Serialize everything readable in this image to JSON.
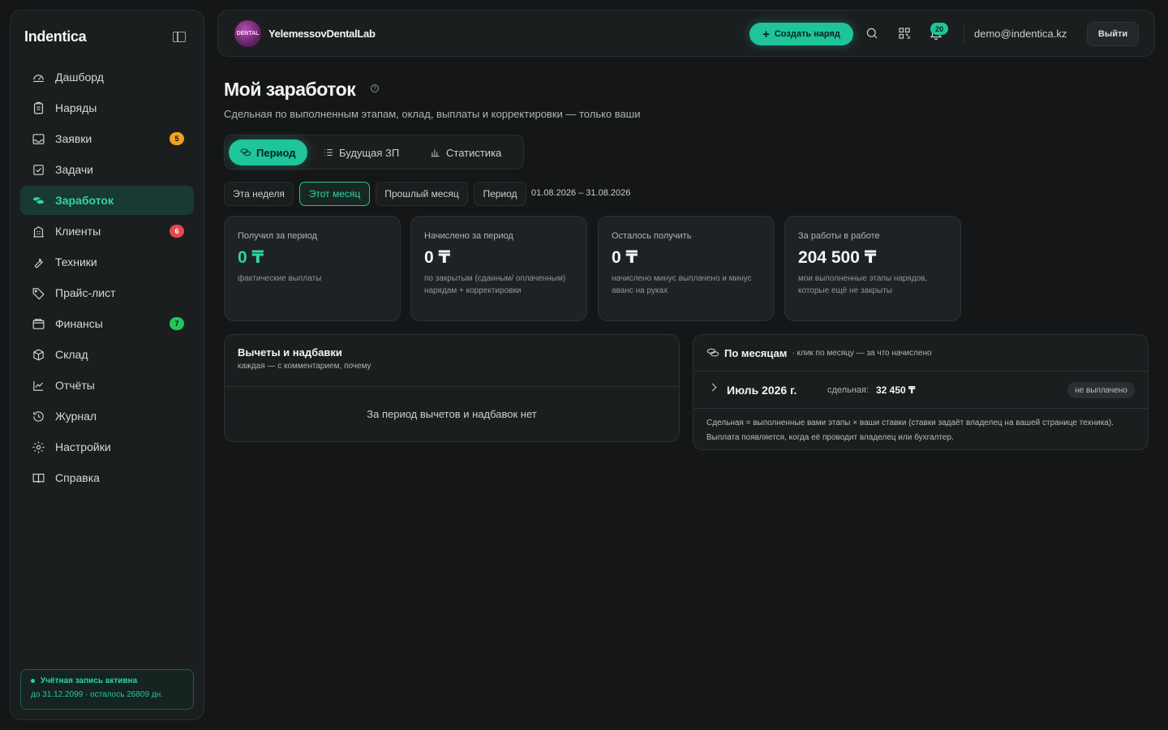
{
  "sidebar": {
    "brand": "Indentica",
    "items": [
      {
        "label": "Дашборд",
        "icon": "dashboard-icon"
      },
      {
        "label": "Наряды",
        "icon": "clipboard-icon"
      },
      {
        "label": "Заявки",
        "icon": "inbox-icon",
        "badge": "5",
        "badge_color": "#f0a020"
      },
      {
        "label": "Задачи",
        "icon": "checkbox-icon"
      },
      {
        "label": "Заработок",
        "icon": "coins-icon",
        "active": true
      },
      {
        "label": "Клиенты",
        "icon": "building-icon",
        "badge": "6",
        "badge_color": "#e5484d"
      },
      {
        "label": "Техники",
        "icon": "wrench-icon"
      },
      {
        "label": "Прайс-лист",
        "icon": "tag-icon"
      },
      {
        "label": "Финансы",
        "icon": "wallet-icon",
        "badge": "7",
        "badge_color": "#22c55e"
      },
      {
        "label": "Склад",
        "icon": "box-icon"
      },
      {
        "label": "Отчёты",
        "icon": "chart-line-icon"
      },
      {
        "label": "Журнал",
        "icon": "history-icon"
      },
      {
        "label": "Настройки",
        "icon": "gear-icon"
      },
      {
        "label": "Справка",
        "icon": "book-icon"
      }
    ],
    "account": {
      "status": "Учётная запись активна",
      "expires": "до 31.12.2099 · осталось 26809 дн."
    }
  },
  "header": {
    "lab_name": "YelemessovDentalLab",
    "avatar_text": "DENTAL",
    "create_label": "Создать наряд",
    "notifications_count": "20",
    "user_email": "demo@indentica.kz",
    "logout_label": "Выйти"
  },
  "page": {
    "title": "Мой заработок",
    "subtitle": "Сдельная по выполненным этапам, оклад, выплаты и корректировки — только ваши"
  },
  "tabs": [
    {
      "label": "Период",
      "active": true
    },
    {
      "label": "Будущая ЗП"
    },
    {
      "label": "Статистика"
    }
  ],
  "filters": {
    "this_week": "Эта неделя",
    "this_month": "Этот месяц",
    "last_month": "Прошлый месяц",
    "period": "Период",
    "range": "01.08.2026 – 31.08.2026"
  },
  "cards": [
    {
      "label": "Получил за период",
      "value": "0 ₸",
      "note": "фактические выплаты"
    },
    {
      "label": "Начислено за период",
      "value": "0 ₸",
      "note": "по закрытым (сданным/ оплаченным) нарядам + корректировки"
    },
    {
      "label": "Осталось получить",
      "value": "0 ₸",
      "note": "начислено минус выплачено и минус аванс на руках"
    },
    {
      "label": "За работы в работе",
      "value": "204 500 ₸",
      "note": "мои выполненные этапы нарядов, которые ещё не закрыты"
    }
  ],
  "deductions": {
    "title": "Вычеты и надбавки",
    "subtitle": "каждая — с комментарием, почему",
    "empty": "За период вычетов и надбавок нет"
  },
  "months": {
    "title": "По месяцам",
    "hint": "· клик по месяцу — за что начислено",
    "rows": [
      {
        "month": "Июль 2026 г.",
        "piece_label": "сдельная:",
        "piece_value": "32 450 ₸",
        "status": "не выплачено"
      }
    ],
    "explain": "Сдельная = выполненные вами этапы × ваши ставки (ставки задаёт владелец на вашей странице техника). Выплата появляется, когда её проводит владелец или бухгалтер."
  },
  "colors": {
    "accent": "#1fc49a",
    "background": "#141617"
  }
}
